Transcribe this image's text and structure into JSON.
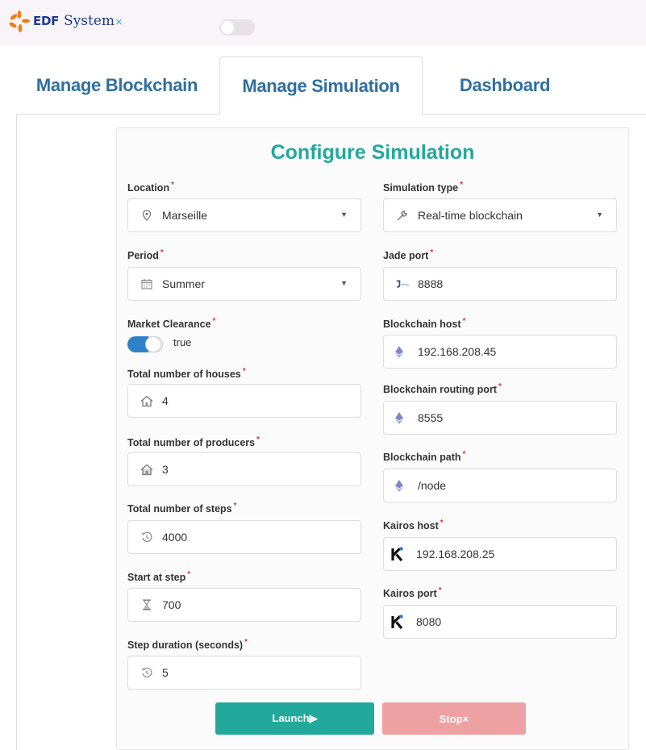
{
  "header": {
    "logo_edf": "EDF",
    "logo_system": "System",
    "logo_x": "×"
  },
  "tabs": [
    {
      "label": "Manage Blockchain"
    },
    {
      "label": "Manage Simulation"
    },
    {
      "label": "Dashboard"
    }
  ],
  "form": {
    "title": "Configure Simulation",
    "required_mark": "*",
    "location": {
      "label": "Location",
      "value": "Marseille",
      "icon": "map-pin-icon"
    },
    "period": {
      "label": "Period",
      "value": "Summer",
      "icon": "calendar-icon"
    },
    "market_clearance": {
      "label": "Market Clearance",
      "value": "true"
    },
    "houses": {
      "label": "Total number of houses",
      "value": "4",
      "icon": "house-icon"
    },
    "producers": {
      "label": "Total number of producers",
      "value": "3",
      "icon": "house-icon"
    },
    "steps": {
      "label": "Total number of steps",
      "value": "4000",
      "icon": "history-icon"
    },
    "start_step": {
      "label": "Start at step",
      "value": "700",
      "icon": "hourglass-icon"
    },
    "step_duration": {
      "label": "Step duration (seconds)",
      "value": "5",
      "icon": "history-icon"
    },
    "simulation_type": {
      "label": "Simulation type",
      "value": "Real-time blockchain",
      "icon": "wrench-icon"
    },
    "jade_port": {
      "label": "Jade port",
      "value": "8888",
      "icon": "jade-icon"
    },
    "blockchain_host": {
      "label": "Blockchain host",
      "value": "192.168.208.45",
      "icon": "ethereum-icon"
    },
    "blockchain_routing_port": {
      "label": "Blockchain routing port",
      "value": "8555",
      "icon": "ethereum-icon"
    },
    "blockchain_path": {
      "label": "Blockchain path",
      "value": "/node",
      "icon": "ethereum-icon"
    },
    "kairos_host": {
      "label": "Kairos host",
      "value": "192.168.208.25",
      "icon": "kairos-icon"
    },
    "kairos_port": {
      "label": "Kairos port",
      "value": "8080",
      "icon": "kairos-icon"
    }
  },
  "buttons": {
    "launch": "Launch▶",
    "stop": "Stop×"
  },
  "colors": {
    "accent": "#22a99b",
    "tab_text": "#2f6fa1",
    "stop": "#eda1a3",
    "toggle_on": "#2f82c8",
    "required": "#e03a3a"
  }
}
